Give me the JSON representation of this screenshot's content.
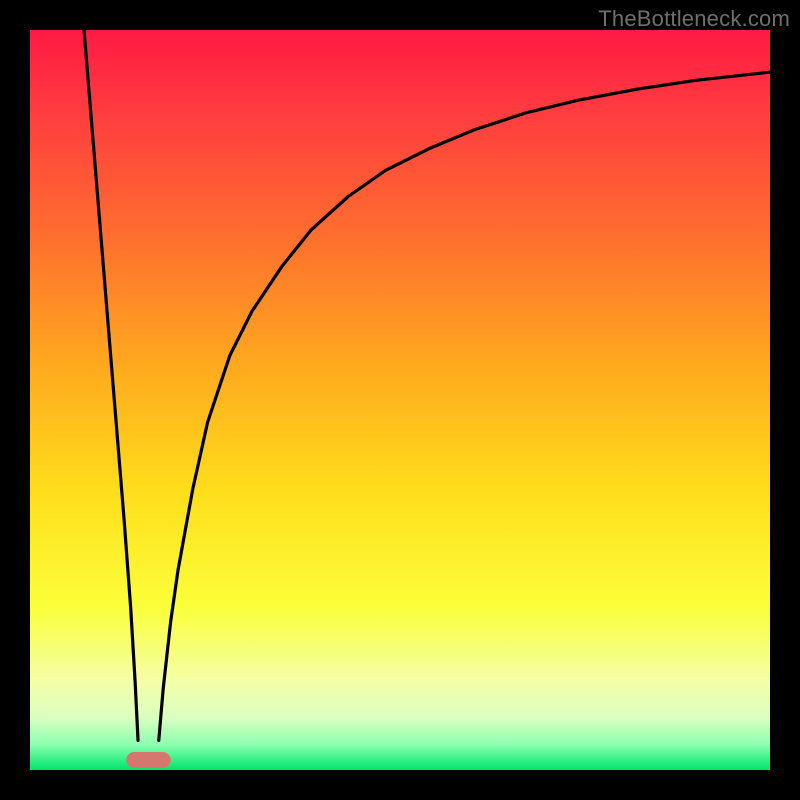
{
  "watermark": "TheBottleneck.com",
  "chart_data": {
    "type": "line",
    "title": "",
    "xlabel": "",
    "ylabel": "",
    "xlim": [
      0,
      100
    ],
    "ylim": [
      0,
      100
    ],
    "grid": false,
    "legend": false,
    "background": {
      "type": "vertical-gradient",
      "stops": [
        {
          "pos": 0.0,
          "color": "#ff1a44"
        },
        {
          "pos": 0.12,
          "color": "#ff3f3f"
        },
        {
          "pos": 0.28,
          "color": "#ff6f2e"
        },
        {
          "pos": 0.45,
          "color": "#ffa81f"
        },
        {
          "pos": 0.62,
          "color": "#ffdd1a"
        },
        {
          "pos": 0.78,
          "color": "#fbff3a"
        },
        {
          "pos": 0.88,
          "color": "#f4ffa8"
        },
        {
          "pos": 0.93,
          "color": "#d9ffc0"
        },
        {
          "pos": 0.965,
          "color": "#8dffb0"
        },
        {
          "pos": 1.0,
          "color": "#00e66b"
        }
      ]
    },
    "optimal_marker": {
      "x": 16,
      "width": 6,
      "color": "#d5776f"
    },
    "series": [
      {
        "name": "left-branch",
        "stroke": "#000000",
        "x": [
          7.3,
          8.2,
          9.1,
          10.0,
          10.9,
          11.8,
          12.7,
          13.6,
          14.2,
          14.6
        ],
        "y": [
          100,
          89,
          78,
          67,
          56,
          45,
          34,
          22,
          12,
          4
        ]
      },
      {
        "name": "right-branch",
        "stroke": "#000000",
        "x": [
          17.4,
          18,
          19,
          20,
          22,
          24,
          27,
          30,
          34,
          38,
          43,
          48,
          54,
          60,
          67,
          74,
          82,
          90,
          100
        ],
        "y": [
          4,
          11,
          20,
          27,
          38,
          47,
          56,
          62,
          68,
          73,
          77.5,
          81,
          84,
          86.5,
          88.8,
          90.5,
          92,
          93.2,
          94.3
        ]
      }
    ]
  }
}
